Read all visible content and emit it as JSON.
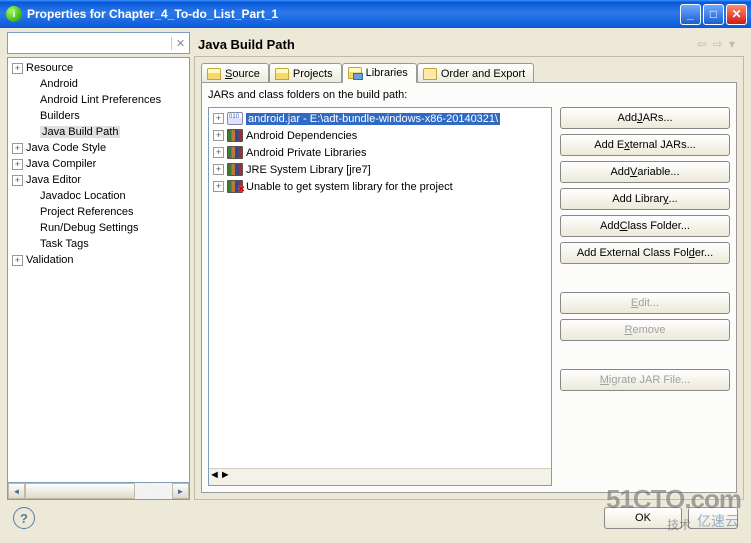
{
  "window": {
    "title": "Properties for Chapter_4_To-do_List_Part_1"
  },
  "tree": {
    "items": [
      {
        "label": "Resource",
        "expandable": true,
        "depth": 0
      },
      {
        "label": "Android",
        "expandable": false,
        "depth": 1
      },
      {
        "label": "Android Lint Preferences",
        "expandable": false,
        "depth": 1
      },
      {
        "label": "Builders",
        "expandable": false,
        "depth": 1
      },
      {
        "label": "Java Build Path",
        "expandable": false,
        "depth": 1,
        "selected": true
      },
      {
        "label": "Java Code Style",
        "expandable": true,
        "depth": 0
      },
      {
        "label": "Java Compiler",
        "expandable": true,
        "depth": 0
      },
      {
        "label": "Java Editor",
        "expandable": true,
        "depth": 0
      },
      {
        "label": "Javadoc Location",
        "expandable": false,
        "depth": 1
      },
      {
        "label": "Project References",
        "expandable": false,
        "depth": 1
      },
      {
        "label": "Run/Debug Settings",
        "expandable": false,
        "depth": 1
      },
      {
        "label": "Task Tags",
        "expandable": false,
        "depth": 1
      },
      {
        "label": "Validation",
        "expandable": true,
        "depth": 0
      }
    ]
  },
  "page": {
    "heading": "Java Build Path"
  },
  "tabs": {
    "source": "Source",
    "projects": "Projects",
    "libraries": "Libraries",
    "order": "Order and Export"
  },
  "libpanel": {
    "description": "JARs and class folders on the build path:",
    "items": [
      {
        "label": "android.jar - E:\\adt-bundle-windows-x86-20140321\\",
        "icon": "jar",
        "selected": true
      },
      {
        "label": "Android Dependencies",
        "icon": "books"
      },
      {
        "label": "Android Private Libraries",
        "icon": "books"
      },
      {
        "label": "JRE System Library [jre7]",
        "icon": "books"
      },
      {
        "label": "Unable to get system library for the project",
        "icon": "books-err"
      }
    ]
  },
  "buttons": {
    "add_jars_pre": "Add ",
    "add_jars_u": "J",
    "add_jars_post": "ARs...",
    "add_ext_jars_pre": "Add E",
    "add_ext_jars_u": "x",
    "add_ext_jars_post": "ternal JARs...",
    "add_var_pre": "Add ",
    "add_var_u": "V",
    "add_var_post": "ariable...",
    "add_lib_pre": "Add Librar",
    "add_lib_u": "y",
    "add_lib_post": "...",
    "add_cf_pre": "Add ",
    "add_cf_u": "C",
    "add_cf_post": "lass Folder...",
    "add_ecf_pre": "Add External Class Fol",
    "add_ecf_u": "d",
    "add_ecf_post": "er...",
    "edit_u": "E",
    "edit_post": "dit...",
    "remove_u": "R",
    "remove_post": "emove",
    "migrate_u": "M",
    "migrate_post": "igrate JAR File..."
  },
  "footer": {
    "ok": "OK"
  },
  "watermarks": {
    "main": "51CTO.com",
    "sub": "亿速云",
    "sub2": "技术"
  }
}
